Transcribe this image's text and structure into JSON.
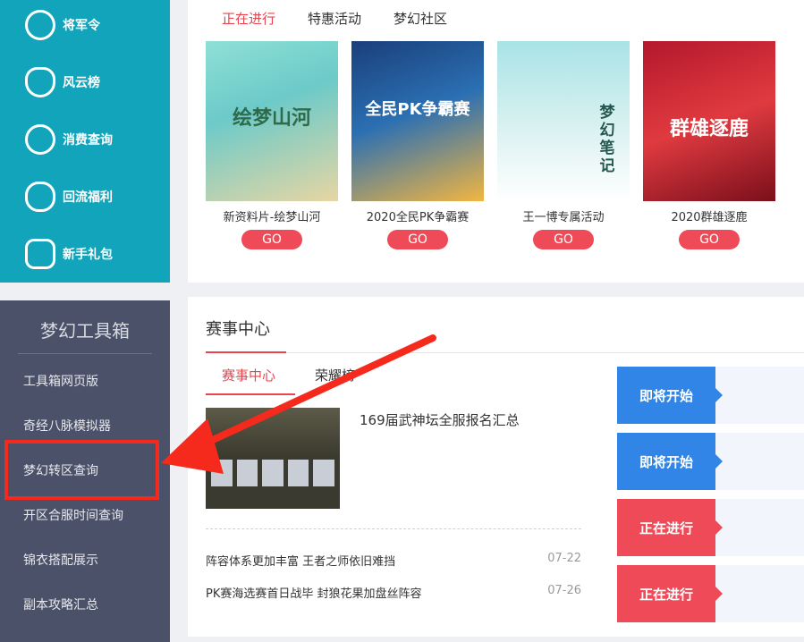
{
  "sidebar": {
    "items": [
      {
        "label": "将军令",
        "icon": "face-icon"
      },
      {
        "label": "风云榜",
        "icon": "trophy-icon"
      },
      {
        "label": "消费查询",
        "icon": "magnifier-icon"
      },
      {
        "label": "回流福利",
        "icon": "gift-bear-icon"
      },
      {
        "label": "新手礼包",
        "icon": "gamepad-icon"
      }
    ]
  },
  "toolbox": {
    "title": "梦幻工具箱",
    "items": [
      "工具箱网页版",
      "奇经八脉模拟器",
      "梦幻转区查询",
      "开区合服时间查询",
      "锦衣搭配展示",
      "副本攻略汇总"
    ]
  },
  "activity": {
    "tabs": [
      "正在进行",
      "特惠活动",
      "梦幻社区"
    ],
    "cards": [
      {
        "label": "新资料片-绘梦山河",
        "art": "绘梦山河",
        "go": "GO"
      },
      {
        "label": "2020全民PK争霸赛",
        "art": "全民PK争霸赛",
        "go": "GO"
      },
      {
        "label": "王一博专属活动",
        "art": "梦幻笔记",
        "go": "GO"
      },
      {
        "label": "2020群雄逐鹿",
        "art": "群雄逐鹿",
        "go": "GO"
      }
    ]
  },
  "events": {
    "title": "赛事中心",
    "sub_tabs": [
      "赛事中心",
      "荣耀榜"
    ],
    "feature_title": "169届武神坛全服报名汇总",
    "news": [
      {
        "title": "阵容体系更加丰富 王者之师依旧难挡",
        "date": "07-22"
      },
      {
        "title": "PK赛海选赛首日战毕 封狼花果加盘丝阵容",
        "date": "07-26"
      }
    ],
    "statuses": [
      {
        "label": "即将开始",
        "color": "#3185e6"
      },
      {
        "label": "即将开始",
        "color": "#3185e6"
      },
      {
        "label": "正在进行",
        "color": "#ef4a57"
      },
      {
        "label": "正在进行",
        "color": "#ef4a57"
      }
    ]
  },
  "colors": {
    "teal": "#12a4bb",
    "accent_red": "#e8434e",
    "annotation_red": "#f52a1c",
    "toolbox_bg": "#4a5168"
  }
}
